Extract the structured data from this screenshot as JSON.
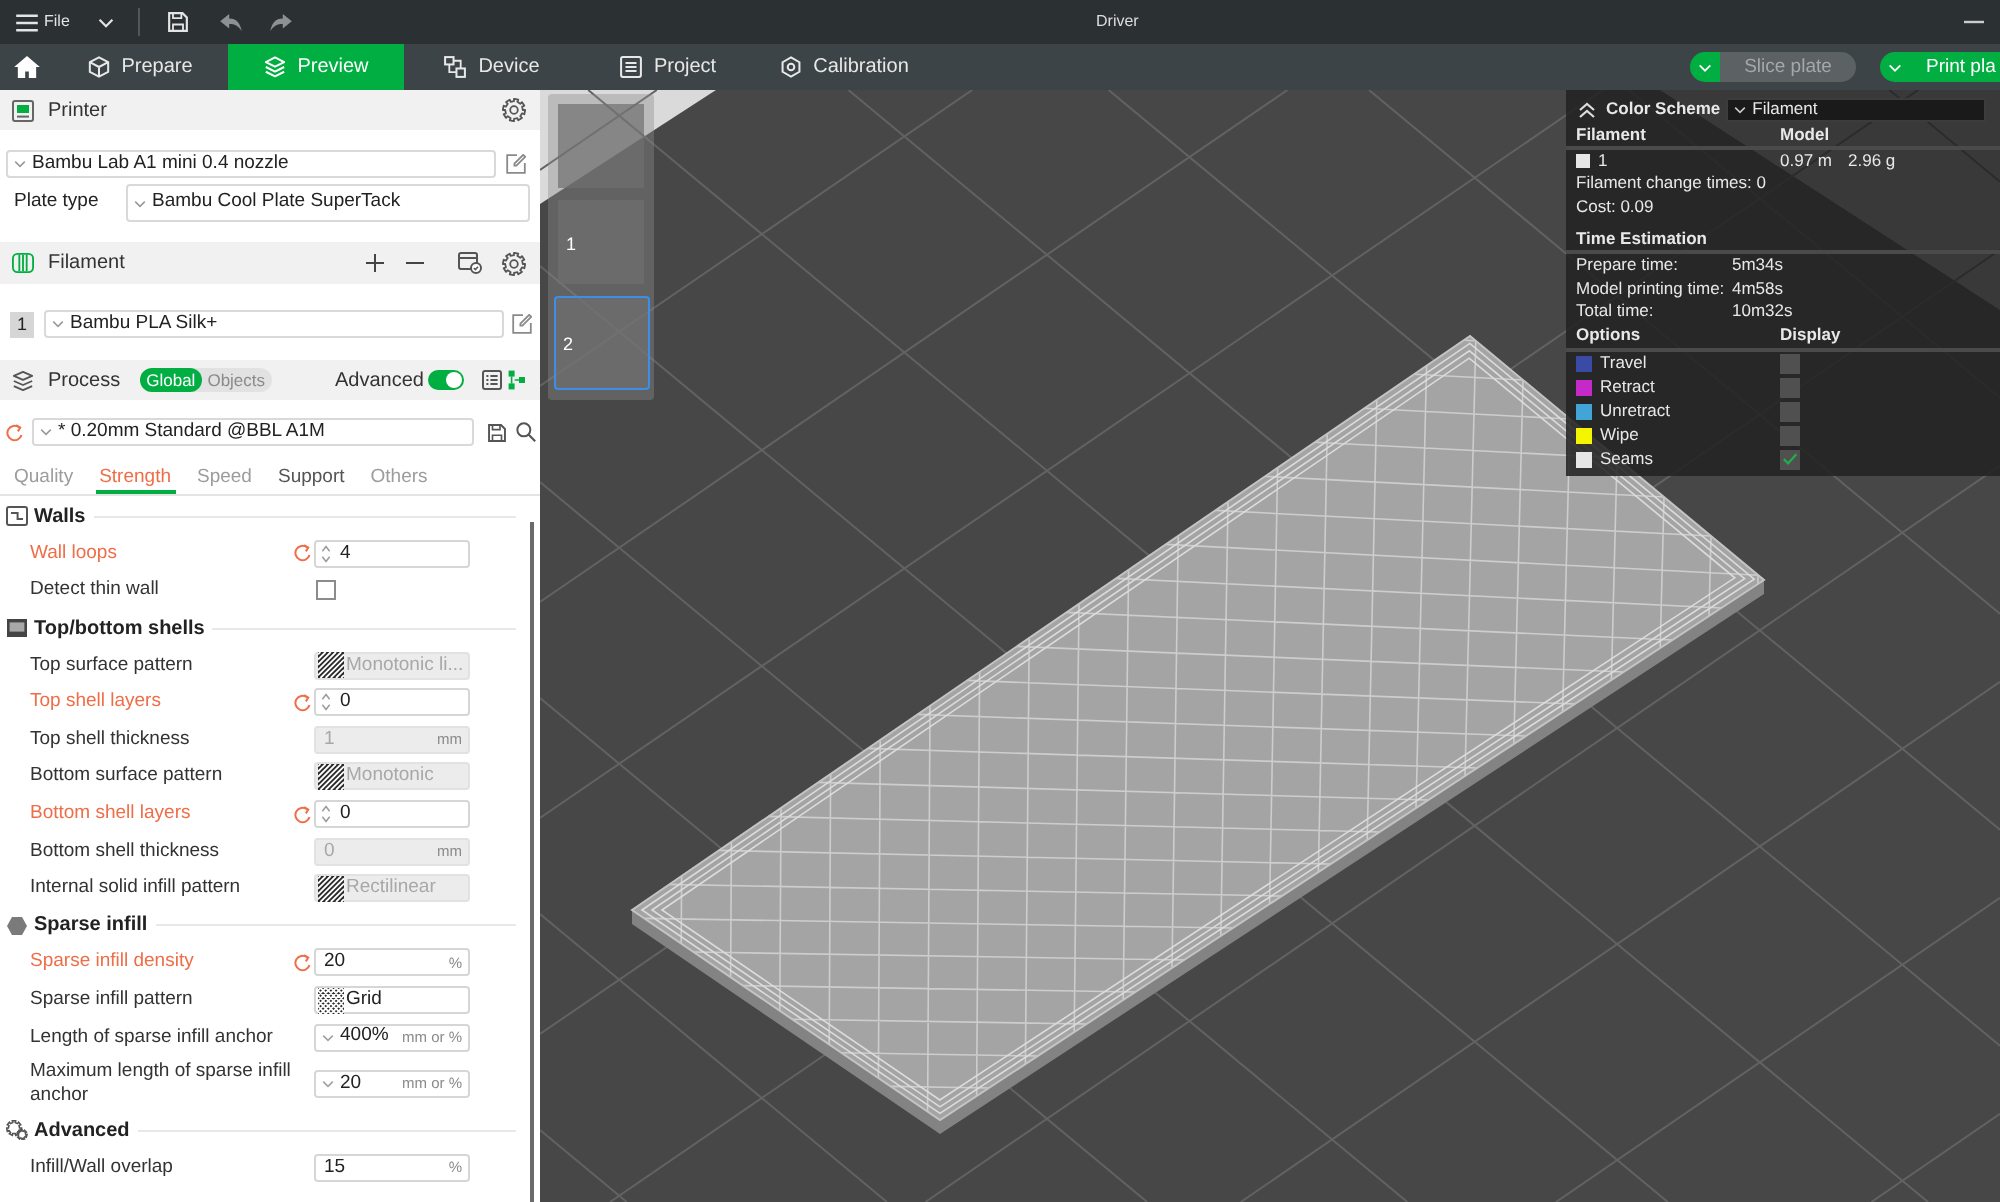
{
  "title_bar": {
    "menu_label": "File",
    "title": "Driver"
  },
  "nav": {
    "tabs": [
      {
        "label": "Prepare",
        "selected": false
      },
      {
        "label": "Preview",
        "selected": true
      },
      {
        "label": "Device",
        "selected": false
      },
      {
        "label": "Project",
        "selected": false
      },
      {
        "label": "Calibration",
        "selected": false
      }
    ],
    "actions": [
      {
        "label": "Slice plate",
        "disabled": true
      },
      {
        "label": "Print pla",
        "disabled": false
      }
    ]
  },
  "printer": {
    "title": "Printer",
    "preset": "Bambu Lab A1 mini 0.4 nozzle",
    "plate_type_label": "Plate type",
    "plate_type": "Bambu Cool Plate SuperTack"
  },
  "filament": {
    "title": "Filament",
    "items": [
      {
        "index": "1",
        "name": "Bambu PLA Silk+"
      }
    ]
  },
  "process": {
    "title": "Process",
    "scope": [
      {
        "label": "Global",
        "selected": true
      },
      {
        "label": "Objects",
        "selected": false
      }
    ],
    "advanced_label": "Advanced",
    "advanced_on": true,
    "preset": "* 0.20mm Standard @BBL A1M",
    "tabs": [
      {
        "label": "Quality",
        "selected": false,
        "hovered": false
      },
      {
        "label": "Strength",
        "selected": true,
        "hovered": false
      },
      {
        "label": "Speed",
        "selected": false,
        "hovered": false
      },
      {
        "label": "Support",
        "selected": false,
        "hovered": true
      },
      {
        "label": "Others",
        "selected": false,
        "hovered": false
      }
    ],
    "sections": [
      {
        "title": "Walls",
        "rows": [
          {
            "label": "Wall loops",
            "modified": true,
            "field": {
              "kind": "spin",
              "value": "4",
              "disabled": false
            }
          },
          {
            "label": "Detect thin wall",
            "modified": false,
            "field": {
              "kind": "checkbox",
              "checked": false
            }
          }
        ]
      },
      {
        "title": "Top/bottom shells",
        "rows": [
          {
            "label": "Top surface pattern",
            "modified": false,
            "field": {
              "kind": "pattern",
              "value": "Monotonic li...",
              "disabled": true
            }
          },
          {
            "label": "Top shell layers",
            "modified": true,
            "field": {
              "kind": "spin",
              "value": "0",
              "disabled": false
            }
          },
          {
            "label": "Top shell thickness",
            "modified": false,
            "field": {
              "kind": "number",
              "value": "1",
              "unit": "mm",
              "disabled": true
            }
          },
          {
            "label": "Bottom surface pattern",
            "modified": false,
            "field": {
              "kind": "pattern",
              "value": "Monotonic",
              "disabled": true
            }
          },
          {
            "label": "Bottom shell layers",
            "modified": true,
            "field": {
              "kind": "spin",
              "value": "0",
              "disabled": false
            }
          },
          {
            "label": "Bottom shell thickness",
            "modified": false,
            "field": {
              "kind": "number",
              "value": "0",
              "unit": "mm",
              "disabled": true
            }
          },
          {
            "label": "Internal solid infill pattern",
            "modified": false,
            "field": {
              "kind": "pattern",
              "value": "Rectilinear",
              "disabled": true
            }
          }
        ]
      },
      {
        "title": "Sparse infill",
        "rows": [
          {
            "label": "Sparse infill density",
            "modified": true,
            "field": {
              "kind": "number",
              "value": "20",
              "unit": "%",
              "disabled": false
            }
          },
          {
            "label": "Sparse infill pattern",
            "modified": false,
            "field": {
              "kind": "pattern",
              "value": "Grid",
              "disabled": false
            }
          },
          {
            "label": "Length of sparse infill anchor",
            "modified": false,
            "field": {
              "kind": "dropdown",
              "value": "400%",
              "unit": "mm or %",
              "disabled": false
            }
          },
          {
            "label": "Maximum length of sparse infill anchor",
            "modified": false,
            "field": {
              "kind": "dropdown",
              "value": "20",
              "unit": "mm or %",
              "disabled": false
            }
          }
        ]
      },
      {
        "title": "Advanced",
        "rows": [
          {
            "label": "Infill/Wall overlap",
            "modified": false,
            "field": {
              "kind": "number",
              "value": "15",
              "unit": "%",
              "disabled": false
            }
          }
        ]
      }
    ]
  },
  "plates": [
    {
      "selected": false
    },
    {
      "label": "1",
      "selected": false
    },
    {
      "label": "2",
      "selected": true
    }
  ],
  "legend": {
    "title": "Color Scheme",
    "scheme": "Filament",
    "usage_columns": [
      "Filament",
      "Model"
    ],
    "filaments": [
      {
        "label": "1",
        "color": "#e6e6e6",
        "length": "0.97 m",
        "weight": "2.96 g"
      }
    ],
    "notes": [
      "Filament change times: 0",
      "Cost: 0.09"
    ],
    "time_title": "Time Estimation",
    "times": [
      {
        "label": "Prepare time:",
        "value": "5m34s"
      },
      {
        "label": "Model printing time:",
        "value": "4m58s"
      },
      {
        "label": "Total time:",
        "value": "10m32s"
      }
    ],
    "option_columns": [
      "Options",
      "Display"
    ],
    "options": [
      {
        "label": "Travel",
        "color": "#3a4ba6",
        "checked": false
      },
      {
        "label": "Retract",
        "color": "#c529c8",
        "checked": false
      },
      {
        "label": "Unretract",
        "color": "#41a6d6",
        "checked": false
      },
      {
        "label": "Wipe",
        "color": "#f5f500",
        "checked": false
      },
      {
        "label": "Seams",
        "color": "#e6e6e6",
        "checked": true
      }
    ]
  }
}
